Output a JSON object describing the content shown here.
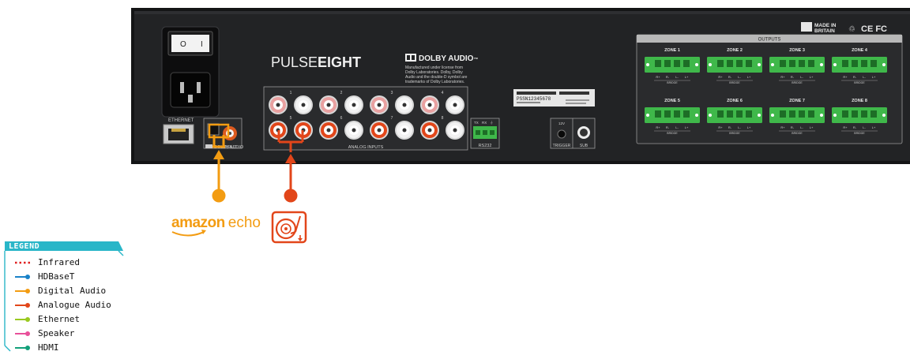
{
  "device": {
    "brand_light": "PULSE",
    "brand_bold": "EIGHT",
    "dolby_title": "DOLBY AUDIO",
    "dolby_tm": "™",
    "dolby_notice": [
      "Manufactured under license from",
      "Dolby Laboratories. Dolby, Dolby",
      "Audio and the double-D symbol are",
      "trademarks of Dolby Laboratories."
    ],
    "made_in": "MADE IN",
    "britain": "BRITAIN",
    "cert_marks": "CE FC",
    "serial": "PSSN12345678",
    "ethernet_label": "ETHERNET",
    "dolby_input_label": "DOLBY AUDIO",
    "input_label": "INPUT",
    "analog_inputs_label": "ANALOG INPUTS",
    "channel_numbers": [
      "1",
      "2",
      "3",
      "4",
      "5",
      "6",
      "7",
      "8"
    ],
    "rs232_label": "RS232",
    "rs232_pins": [
      "TX",
      "RX",
      "⏚"
    ],
    "trigger_label": "TRIGGER",
    "trigger_voltage": "12V",
    "sub_label": "SUB",
    "outputs_label": "OUTPUTS",
    "zones": [
      "ZONE 1",
      "ZONE 2",
      "ZONE 3",
      "ZONE 4",
      "ZONE 5",
      "ZONE 6",
      "ZONE 7",
      "ZONE 8"
    ],
    "zone_pins": [
      "R+",
      "R-",
      "L-",
      "L+"
    ],
    "bridge_label": "BRIDGE"
  },
  "sources": {
    "amazon_part1": "amazon",
    "amazon_part2": "echo",
    "turntable_icon": "turntable-icon"
  },
  "legend": {
    "title": "LEGEND",
    "items": [
      {
        "label": "Infrared",
        "color": "#e02020",
        "style": "dotted"
      },
      {
        "label": "HDBaseT",
        "color": "#1a82c8",
        "style": "solid"
      },
      {
        "label": "Digital Audio",
        "color": "#f39c12",
        "style": "solid"
      },
      {
        "label": "Analogue Audio",
        "color": "#e2461a",
        "style": "solid"
      },
      {
        "label": "Ethernet",
        "color": "#9ac920",
        "style": "solid"
      },
      {
        "label": "Speaker",
        "color": "#e8509a",
        "style": "solid"
      },
      {
        "label": "HDMI",
        "color": "#12a07a",
        "style": "solid"
      }
    ]
  },
  "colors": {
    "chassis": "#1e1f21",
    "digital_audio": "#f39c12",
    "analogue_audio": "#e2461a",
    "legend_accent": "#29b6c8",
    "terminal_green": "#3fb84a"
  }
}
